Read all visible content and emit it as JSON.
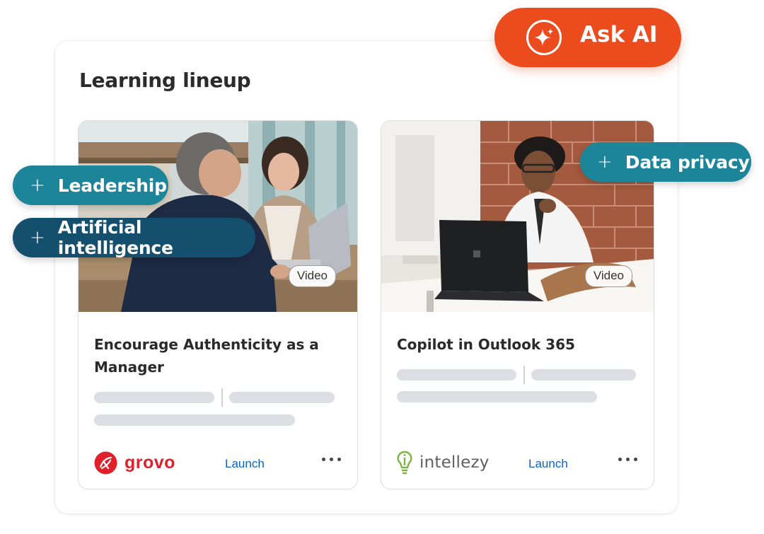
{
  "panel": {
    "title": "Learning lineup"
  },
  "ask_ai": {
    "label": "Ask AI",
    "color": "#ec4b1d"
  },
  "chips": [
    {
      "label": "Leadership",
      "color": "#1c8599"
    },
    {
      "label": "Artificial intelligence",
      "color": "#14506e"
    },
    {
      "label": "Data privacy",
      "color": "#1c8599"
    }
  ],
  "cards": [
    {
      "badge": "Video",
      "title": "Encourage Authenticity as a Manager",
      "provider": "grovo",
      "provider_color": "#e0202a",
      "launch": "Launch"
    },
    {
      "badge": "Video",
      "title": "Copilot in Outlook 365",
      "provider": "intellezy",
      "provider_color": "#7cb342",
      "launch": "Launch"
    }
  ]
}
